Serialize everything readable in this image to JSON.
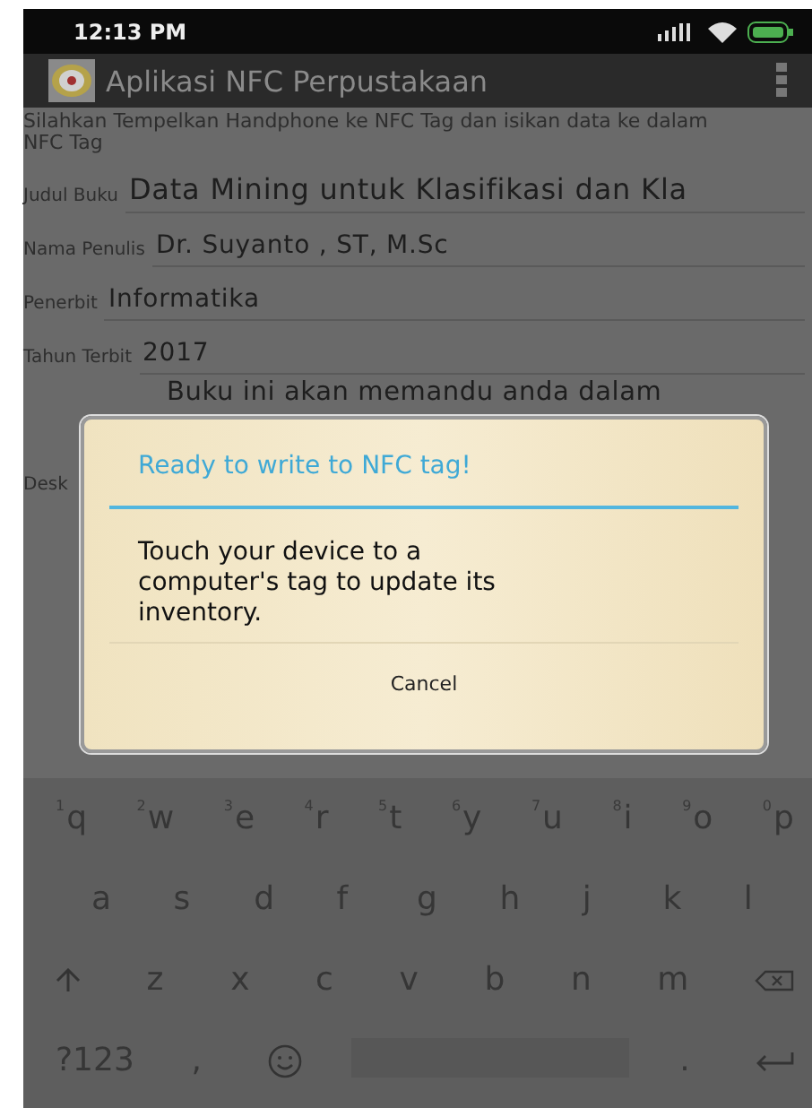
{
  "status_bar": {
    "time": "12:13 PM"
  },
  "app_bar": {
    "title": "Aplikasi NFC Perpustakaan"
  },
  "instruction": "Silahkan Tempelkan Handphone ke NFC Tag dan isikan data ke dalam NFC Tag",
  "fields": [
    {
      "label": "Judul Buku",
      "value": "Data Mining untuk Klasifikasi dan Kla"
    },
    {
      "label": "Nama Penulis",
      "value": "Dr. Suyanto , ST, M.Sc"
    },
    {
      "label": "Penerbit",
      "value": "Informatika"
    },
    {
      "label": "Tahun Terbit",
      "value": "2017"
    }
  ],
  "description": {
    "label": "Desk",
    "value": "Buku ini akan memandu anda dalam"
  },
  "dialog": {
    "title": "Ready to write to NFC tag!",
    "message": "Touch your device to a computer's tag to update its inventory.",
    "button": "Cancel"
  },
  "keyboard": {
    "rows": [
      [
        {
          "kind": "char",
          "key": "q",
          "hint": "1"
        },
        {
          "kind": "char",
          "key": "w",
          "hint": "2"
        },
        {
          "kind": "char",
          "key": "e",
          "hint": "3"
        },
        {
          "kind": "char",
          "key": "r",
          "hint": "4"
        },
        {
          "kind": "char",
          "key": "t",
          "hint": "5"
        },
        {
          "kind": "char",
          "key": "y",
          "hint": "6"
        },
        {
          "kind": "char",
          "key": "u",
          "hint": "7"
        },
        {
          "kind": "char",
          "key": "i",
          "hint": "8"
        },
        {
          "kind": "char",
          "key": "o",
          "hint": "9"
        },
        {
          "kind": "char",
          "key": "p",
          "hint": "0"
        }
      ],
      [
        {
          "kind": "char",
          "key": "a"
        },
        {
          "kind": "char",
          "key": "s"
        },
        {
          "kind": "char",
          "key": "d"
        },
        {
          "kind": "char",
          "key": "f"
        },
        {
          "kind": "char",
          "key": "g"
        },
        {
          "kind": "char",
          "key": "h"
        },
        {
          "kind": "char",
          "key": "j"
        },
        {
          "kind": "char",
          "key": "k"
        },
        {
          "kind": "char",
          "key": "l"
        }
      ],
      [
        {
          "kind": "shift"
        },
        {
          "kind": "char",
          "key": "z"
        },
        {
          "kind": "char",
          "key": "x"
        },
        {
          "kind": "char",
          "key": "c"
        },
        {
          "kind": "char",
          "key": "v"
        },
        {
          "kind": "char",
          "key": "b"
        },
        {
          "kind": "char",
          "key": "n"
        },
        {
          "kind": "char",
          "key": "m"
        },
        {
          "kind": "backspace"
        }
      ],
      [
        {
          "kind": "char",
          "key": "?123"
        },
        {
          "kind": "char",
          "key": ","
        },
        {
          "kind": "emoji"
        },
        {
          "kind": "space"
        },
        {
          "kind": "char",
          "key": "."
        },
        {
          "kind": "enter"
        }
      ]
    ]
  }
}
